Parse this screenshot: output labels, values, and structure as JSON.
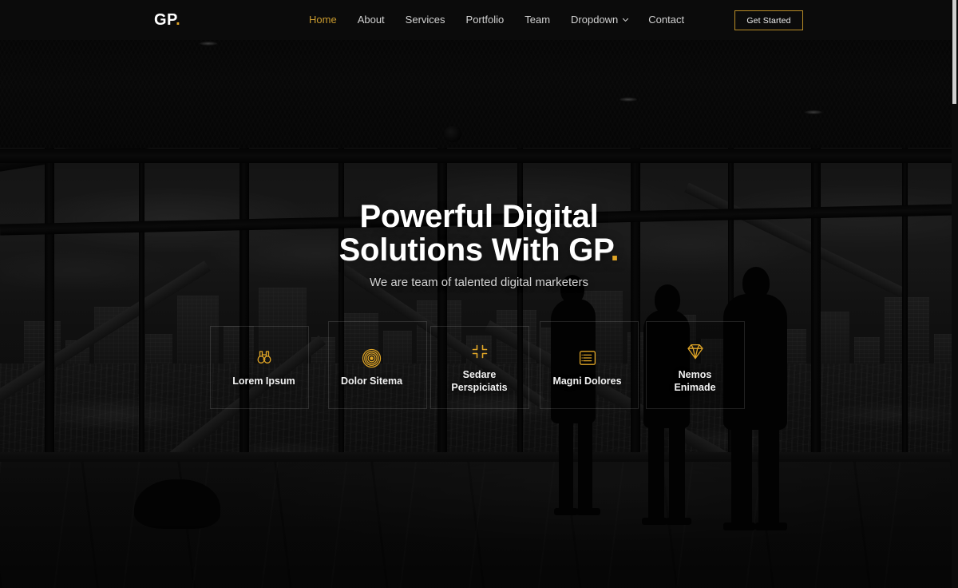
{
  "header": {
    "logo_text": "GP",
    "logo_dot": ".",
    "nav": [
      {
        "label": "Home",
        "active": true,
        "caret": false
      },
      {
        "label": "About",
        "active": false,
        "caret": false
      },
      {
        "label": "Services",
        "active": false,
        "caret": false
      },
      {
        "label": "Portfolio",
        "active": false,
        "caret": false
      },
      {
        "label": "Team",
        "active": false,
        "caret": false
      },
      {
        "label": "Dropdown",
        "active": false,
        "caret": true
      },
      {
        "label": "Contact",
        "active": false,
        "caret": false
      }
    ],
    "cta_label": "Get Started"
  },
  "hero": {
    "title_line1": "Powerful Digital",
    "title_line2": "Solutions With GP",
    "title_dot": ".",
    "subtitle": "We are team of talented digital marketers"
  },
  "features": [
    {
      "label": "Lorem Ipsum",
      "icon": "binoculars-icon"
    },
    {
      "label": "Dolor Sitema",
      "icon": "bullseye-icon"
    },
    {
      "label": "Sedare\nPerspiciatis",
      "icon": "fullscreen-exit-icon"
    },
    {
      "label": "Magni Dolores",
      "icon": "list-icon"
    },
    {
      "label": "Nemos\nEnimade",
      "icon": "gem-icon"
    }
  ],
  "colors": {
    "accent": "#e0a526",
    "accent_nav": "#c99a2e",
    "accent_border": "#b98c27",
    "header_bg": "#0b0b0b",
    "text_primary": "#ffffff",
    "text_muted": "#d5d5d5"
  }
}
